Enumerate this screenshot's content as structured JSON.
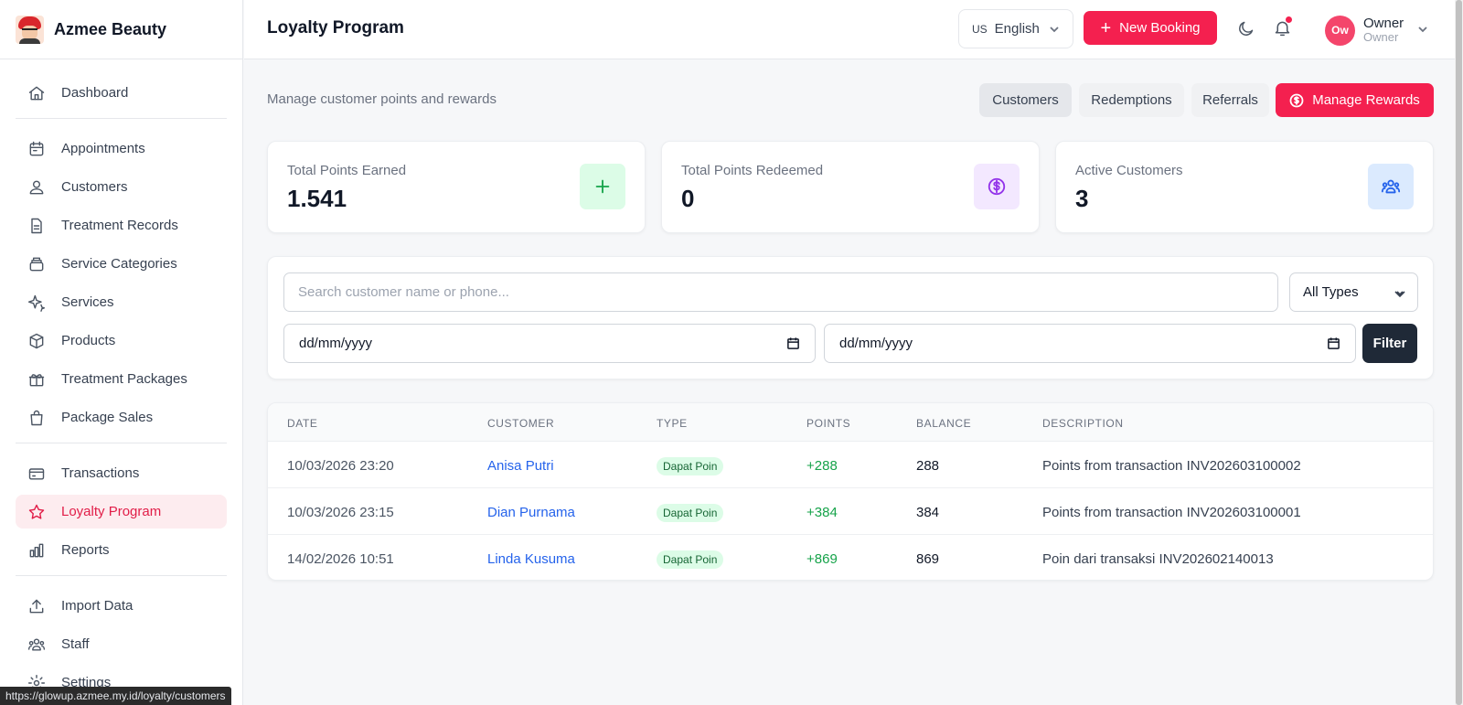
{
  "brand": {
    "name": "Azmee Beauty"
  },
  "sidebar": {
    "groups": [
      [
        {
          "label": "Dashboard",
          "icon": "home-icon"
        }
      ],
      [
        {
          "label": "Appointments",
          "icon": "calendar-icon"
        },
        {
          "label": "Customers",
          "icon": "users-icon"
        },
        {
          "label": "Treatment Records",
          "icon": "file-icon"
        },
        {
          "label": "Service Categories",
          "icon": "layers-icon"
        },
        {
          "label": "Services",
          "icon": "sparkles-icon"
        },
        {
          "label": "Products",
          "icon": "box-icon"
        },
        {
          "label": "Treatment Packages",
          "icon": "gift-icon"
        },
        {
          "label": "Package Sales",
          "icon": "shopping-bag-icon"
        }
      ],
      [
        {
          "label": "Transactions",
          "icon": "credit-card-icon"
        },
        {
          "label": "Loyalty Program",
          "icon": "star-icon",
          "active": true
        },
        {
          "label": "Reports",
          "icon": "bar-chart-icon"
        }
      ],
      [
        {
          "label": "Import Data",
          "icon": "upload-icon"
        },
        {
          "label": "Staff",
          "icon": "team-icon"
        },
        {
          "label": "Settings",
          "icon": "gear-icon"
        }
      ]
    ]
  },
  "status_url": "https://glowup.azmee.my.id/loyalty/customers",
  "header": {
    "title": "Loyalty Program",
    "language_flag": "US",
    "language": "English",
    "new_booking": "New Booking",
    "user_initials": "Ow",
    "user_name": "Owner",
    "user_role": "Owner"
  },
  "main": {
    "subtitle": "Manage customer points and rewards",
    "tabs": [
      {
        "label": "Customers",
        "active": true
      },
      {
        "label": "Redemptions"
      },
      {
        "label": "Referrals"
      }
    ],
    "manage_rewards": "Manage Rewards",
    "stats": [
      {
        "label": "Total Points Earned",
        "value": "1.541",
        "icon": "plus-icon"
      },
      {
        "label": "Total Points Redeemed",
        "value": "0",
        "icon": "dollar-circle-icon"
      },
      {
        "label": "Active Customers",
        "value": "3",
        "icon": "group-icon"
      }
    ],
    "filters": {
      "search_placeholder": "Search customer name or phone...",
      "type_value": "All Types",
      "date_from": "dd/mm/yyyy",
      "date_to": "dd/mm/yyyy",
      "filter_button": "Filter"
    },
    "table": {
      "columns": [
        "DATE",
        "CUSTOMER",
        "TYPE",
        "POINTS",
        "BALANCE",
        "DESCRIPTION"
      ],
      "rows": [
        {
          "date": "10/03/2026 23:20",
          "customer": "Anisa Putri",
          "type": "Dapat Poin",
          "points": "+288",
          "balance": "288",
          "description": "Points from transaction INV202603100002"
        },
        {
          "date": "10/03/2026 23:15",
          "customer": "Dian Purnama",
          "type": "Dapat Poin",
          "points": "+384",
          "balance": "384",
          "description": "Points from transaction INV202603100001"
        },
        {
          "date": "14/02/2026 10:51",
          "customer": "Linda Kusuma",
          "type": "Dapat Poin",
          "points": "+869",
          "balance": "869",
          "description": "Poin dari transaksi INV202602140013"
        }
      ]
    }
  },
  "colors": {
    "accent": "#f4204f",
    "active_bg": "#fdecef",
    "link": "#2563eb",
    "positive": "#16a34a"
  }
}
